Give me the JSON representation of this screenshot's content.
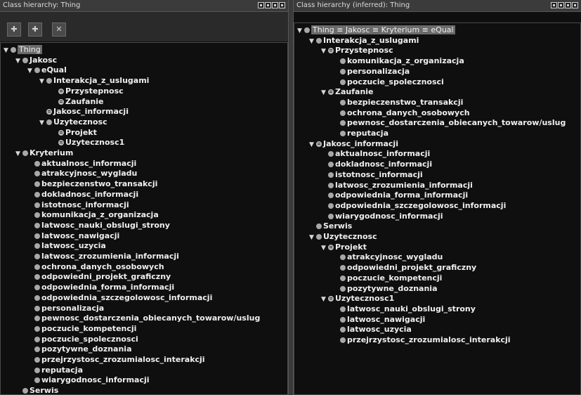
{
  "left": {
    "title": "Class hierarchy: Thing",
    "tools": [
      {
        "name": "add-subclass-icon",
        "glyph": "✚"
      },
      {
        "name": "add-sibling-icon",
        "glyph": "✚"
      },
      {
        "name": "delete-class-icon",
        "glyph": "✕"
      }
    ],
    "tree": [
      {
        "label": "Thing",
        "depth": 0,
        "type": "root",
        "arrow": "▼"
      },
      {
        "label": "Jakosc",
        "depth": 1,
        "arrow": "▼"
      },
      {
        "label": "eQual",
        "depth": 2,
        "arrow": "▼"
      },
      {
        "label": "Interakcja_z_uslugami",
        "depth": 3,
        "arrow": "▼"
      },
      {
        "label": "Przystepnosc",
        "depth": 4,
        "type": "eq"
      },
      {
        "label": "Zaufanie",
        "depth": 4,
        "type": "eq"
      },
      {
        "label": "Jakosc_informacji",
        "depth": 3,
        "type": "eq"
      },
      {
        "label": "Uzytecznosc",
        "depth": 3,
        "arrow": "▼"
      },
      {
        "label": "Projekt",
        "depth": 4,
        "type": "eq"
      },
      {
        "label": "Uzytecznosc1",
        "depth": 4,
        "type": "eq"
      },
      {
        "label": "Kryterium",
        "depth": 1,
        "arrow": "▼"
      },
      {
        "label": "aktualnosc_informacji",
        "depth": 2
      },
      {
        "label": "atrakcyjnosc_wygladu",
        "depth": 2
      },
      {
        "label": "bezpieczenstwo_transakcji",
        "depth": 2
      },
      {
        "label": "dokladnosc_informacji",
        "depth": 2
      },
      {
        "label": "istotnosc_informacji",
        "depth": 2
      },
      {
        "label": "komunikacja_z_organizacja",
        "depth": 2
      },
      {
        "label": "latwosc_nauki_obslugi_strony",
        "depth": 2
      },
      {
        "label": "latwosc_nawigacji",
        "depth": 2
      },
      {
        "label": "latwosc_uzycia",
        "depth": 2
      },
      {
        "label": "latwosc_zrozumienia_informacji",
        "depth": 2
      },
      {
        "label": "ochrona_danych_osobowych",
        "depth": 2
      },
      {
        "label": "odpowiedni_projekt_graficzny",
        "depth": 2
      },
      {
        "label": "odpowiednia_forma_informacji",
        "depth": 2
      },
      {
        "label": "odpowiednia_szczegolowosc_informacji",
        "depth": 2
      },
      {
        "label": "personalizacja",
        "depth": 2
      },
      {
        "label": "pewnosc_dostarczenia_obiecanych_towarow/uslug",
        "depth": 2
      },
      {
        "label": "poczucie_kompetencji",
        "depth": 2
      },
      {
        "label": "poczucie_spolecznosci",
        "depth": 2
      },
      {
        "label": "pozytywne_doznania",
        "depth": 2
      },
      {
        "label": "przejrzystosc_zrozumialosc_interakcji",
        "depth": 2
      },
      {
        "label": "reputacja",
        "depth": 2
      },
      {
        "label": "wiarygodnosc_informacji",
        "depth": 2
      },
      {
        "label": "Serwis",
        "depth": 1
      }
    ]
  },
  "right": {
    "title": "Class hierarchy (inferred): Thing",
    "tree": [
      {
        "label": "Thing ≡ Jakosc ≡ Kryterium ≡ eQual",
        "depth": 0,
        "type": "root",
        "arrow": "▼"
      },
      {
        "label": "Interakcja_z_uslugami",
        "depth": 1,
        "arrow": "▼"
      },
      {
        "label": "Przystepnosc",
        "depth": 2,
        "type": "eq",
        "arrow": "▼"
      },
      {
        "label": "komunikacja_z_organizacja",
        "depth": 3
      },
      {
        "label": "personalizacja",
        "depth": 3
      },
      {
        "label": "poczucie_spolecznosci",
        "depth": 3
      },
      {
        "label": "Zaufanie",
        "depth": 2,
        "type": "eq",
        "arrow": "▼"
      },
      {
        "label": "bezpieczenstwo_transakcji",
        "depth": 3
      },
      {
        "label": "ochrona_danych_osobowych",
        "depth": 3
      },
      {
        "label": "pewnosc_dostarczenia_obiecanych_towarow/uslug",
        "depth": 3
      },
      {
        "label": "reputacja",
        "depth": 3
      },
      {
        "label": "Jakosc_informacji",
        "depth": 1,
        "type": "eq",
        "arrow": "▼"
      },
      {
        "label": "aktualnosc_informacji",
        "depth": 2
      },
      {
        "label": "dokladnosc_informacji",
        "depth": 2
      },
      {
        "label": "istotnosc_informacji",
        "depth": 2
      },
      {
        "label": "latwosc_zrozumienia_informacji",
        "depth": 2
      },
      {
        "label": "odpowiednia_forma_informacji",
        "depth": 2
      },
      {
        "label": "odpowiednia_szczegolowosc_informacji",
        "depth": 2
      },
      {
        "label": "wiarygodnosc_informacji",
        "depth": 2
      },
      {
        "label": "Serwis",
        "depth": 1
      },
      {
        "label": "Uzytecznosc",
        "depth": 1,
        "arrow": "▼"
      },
      {
        "label": "Projekt",
        "depth": 2,
        "type": "eq",
        "arrow": "▼"
      },
      {
        "label": "atrakcyjnosc_wygladu",
        "depth": 3
      },
      {
        "label": "odpowiedni_projekt_graficzny",
        "depth": 3
      },
      {
        "label": "poczucie_kompetencji",
        "depth": 3
      },
      {
        "label": "pozytywne_doznania",
        "depth": 3
      },
      {
        "label": "Uzytecznosc1",
        "depth": 2,
        "type": "eq",
        "arrow": "▼"
      },
      {
        "label": "latwosc_nauki_obslugi_strony",
        "depth": 3
      },
      {
        "label": "latwosc_nawigacji",
        "depth": 3
      },
      {
        "label": "latwosc_uzycia",
        "depth": 3
      },
      {
        "label": "przejrzystosc_zrozumialosc_interakcji",
        "depth": 3
      }
    ]
  }
}
